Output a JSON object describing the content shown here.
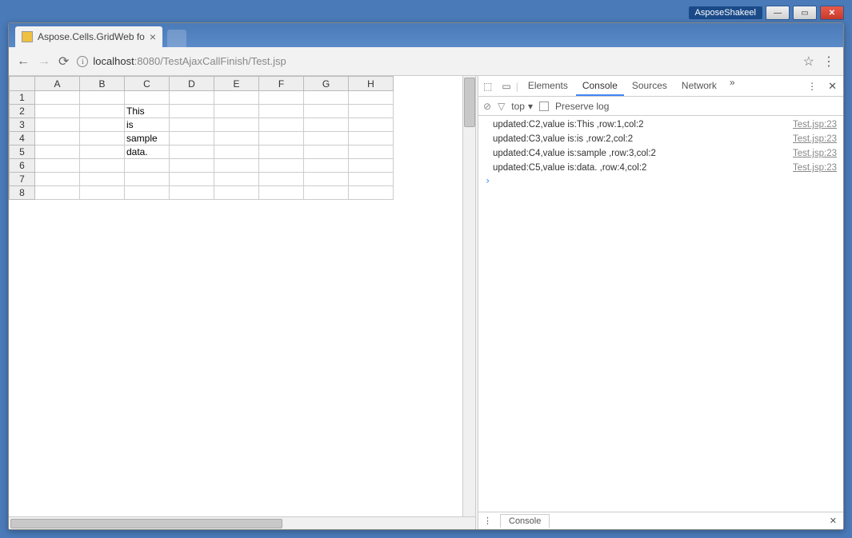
{
  "window": {
    "owner_label": "AsposeShakeel"
  },
  "browser": {
    "tab_title": "Aspose.Cells.GridWeb fo",
    "url": {
      "host": "localhost",
      "port": ":8080",
      "path": "/TestAjaxCallFinish/Test.jsp"
    }
  },
  "sheet": {
    "columns": [
      "A",
      "B",
      "C",
      "D",
      "E",
      "F",
      "G",
      "H"
    ],
    "rows": [
      "1",
      "2",
      "3",
      "4",
      "5",
      "6",
      "7",
      "8"
    ],
    "cells": {
      "C2": "This",
      "C3": "is",
      "C4": "sample",
      "C5": "data."
    }
  },
  "devtools": {
    "tabs": {
      "elements": "Elements",
      "console": "Console",
      "sources": "Sources",
      "network": "Network"
    },
    "toolbar": {
      "context": "top",
      "preserve_log_label": "Preserve log"
    },
    "logs": [
      {
        "msg": "updated:C2,value is:This ,row:1,col:2",
        "src": "Test.jsp:23"
      },
      {
        "msg": "updated:C3,value is:is ,row:2,col:2",
        "src": "Test.jsp:23"
      },
      {
        "msg": "updated:C4,value is:sample ,row:3,col:2",
        "src": "Test.jsp:23"
      },
      {
        "msg": "updated:C5,value is:data. ,row:4,col:2",
        "src": "Test.jsp:23"
      }
    ],
    "drawer_tab": "Console"
  }
}
